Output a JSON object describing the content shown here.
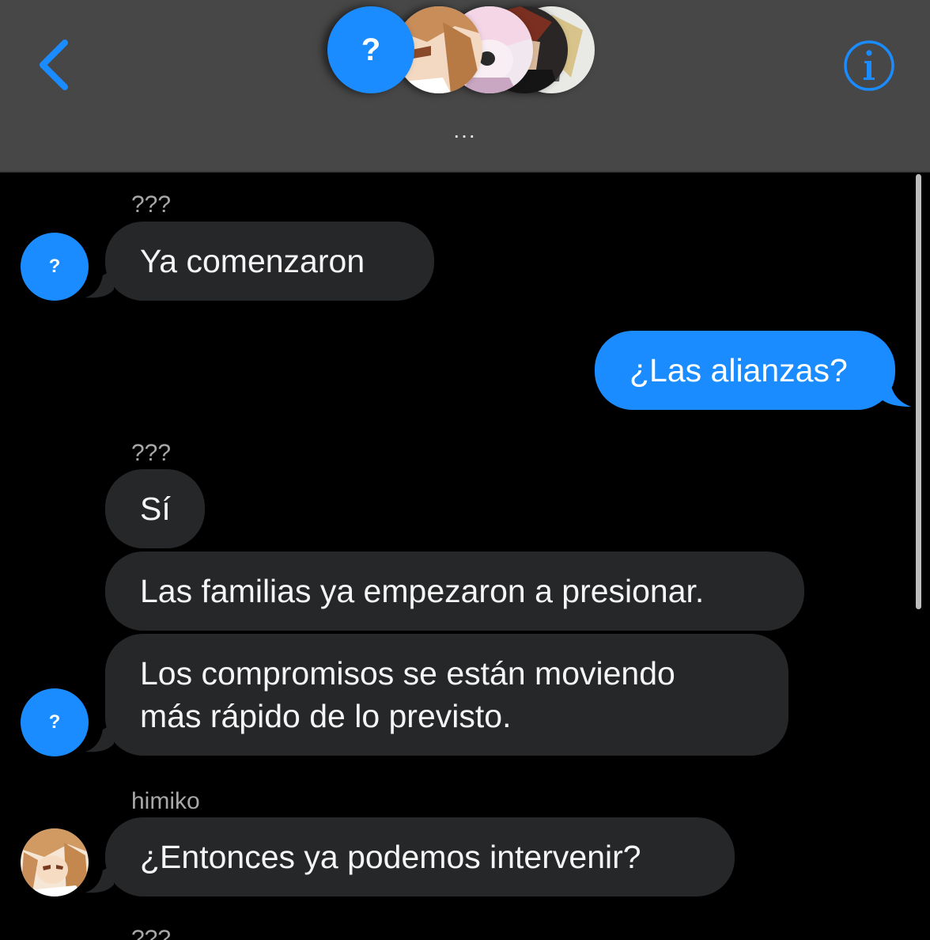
{
  "header": {
    "back_icon": "chevron-left-icon",
    "info_icon": "info-circle-icon",
    "group_first_avatar_label": "?",
    "group_title": "...",
    "accent_color": "#1a8cff"
  },
  "messages": [
    {
      "sender": "???",
      "text": "Ya comenzaron",
      "avatar_label": "?"
    },
    {
      "text": "¿Las alianzas?",
      "outgoing": true
    },
    {
      "sender": "???",
      "text": "Sí"
    },
    {
      "text": "Las familias ya empezaron a presionar."
    },
    {
      "text": "Los compromisos se están moviendo\nmás rápido de lo previsto.",
      "avatar_label": "?"
    },
    {
      "sender": "himiko",
      "text": "¿Entonces ya podemos intervenir?"
    },
    {
      "sender": "???"
    }
  ],
  "colors": {
    "incoming_bubble": "#262729",
    "outgoing_bubble": "#1a8cff",
    "header_bg": "#474747",
    "background": "#000000"
  }
}
